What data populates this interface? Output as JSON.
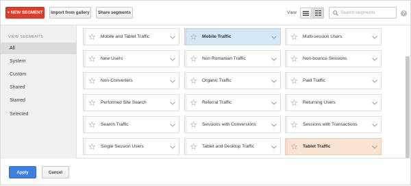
{
  "toolbar": {
    "new_segment_label": "+ NEW SEGMENT",
    "import_label": "Import from gallery",
    "share_label": "Share segments",
    "view_label": "View",
    "search_placeholder": "Search segments",
    "help_label": "?"
  },
  "sidebar": {
    "title": "VIEW SEGMENTS",
    "items": [
      {
        "label": "All",
        "active": true
      },
      {
        "label": "System",
        "active": false
      },
      {
        "label": "Custom",
        "active": false
      },
      {
        "label": "Shared",
        "active": false
      },
      {
        "label": "Starred",
        "active": false
      },
      {
        "label": "Selected",
        "active": false
      }
    ]
  },
  "segments": [
    {
      "label": "Mobile and Tablet Traffic",
      "highlight": "",
      "bold": false
    },
    {
      "label": "Mobile Traffic",
      "highlight": "blue",
      "bold": true
    },
    {
      "label": "Multi-session Users",
      "highlight": "",
      "bold": false
    },
    {
      "label": "New Users",
      "highlight": "",
      "bold": false
    },
    {
      "label": "Non Romanian Traffic",
      "highlight": "",
      "bold": false
    },
    {
      "label": "Non-bounce Sessions",
      "highlight": "",
      "bold": false
    },
    {
      "label": "Non-Converters",
      "highlight": "",
      "bold": false
    },
    {
      "label": "Organic Traffic",
      "highlight": "",
      "bold": false
    },
    {
      "label": "Paid Traffic",
      "highlight": "",
      "bold": false
    },
    {
      "label": "Performed Site Search",
      "highlight": "",
      "bold": false
    },
    {
      "label": "Referral Traffic",
      "highlight": "",
      "bold": false
    },
    {
      "label": "Returning Users",
      "highlight": "",
      "bold": false
    },
    {
      "label": "Search Traffic",
      "highlight": "",
      "bold": false
    },
    {
      "label": "Sessions with Conversions",
      "highlight": "",
      "bold": false
    },
    {
      "label": "Sessions with Transactions",
      "highlight": "",
      "bold": false
    },
    {
      "label": "Single Session Users",
      "highlight": "",
      "bold": false
    },
    {
      "label": "Tablet and Desktop Traffic",
      "highlight": "",
      "bold": false
    },
    {
      "label": "Tablet Traffic",
      "highlight": "peach",
      "bold": true
    }
  ],
  "footer": {
    "apply_label": "Apply",
    "cancel_label": "Cancel"
  },
  "colors": {
    "new_segment": "#d8402d",
    "apply": "#3f7fe0",
    "selected_blue": "#d4e7f6",
    "selected_peach": "#fbe3d1"
  }
}
